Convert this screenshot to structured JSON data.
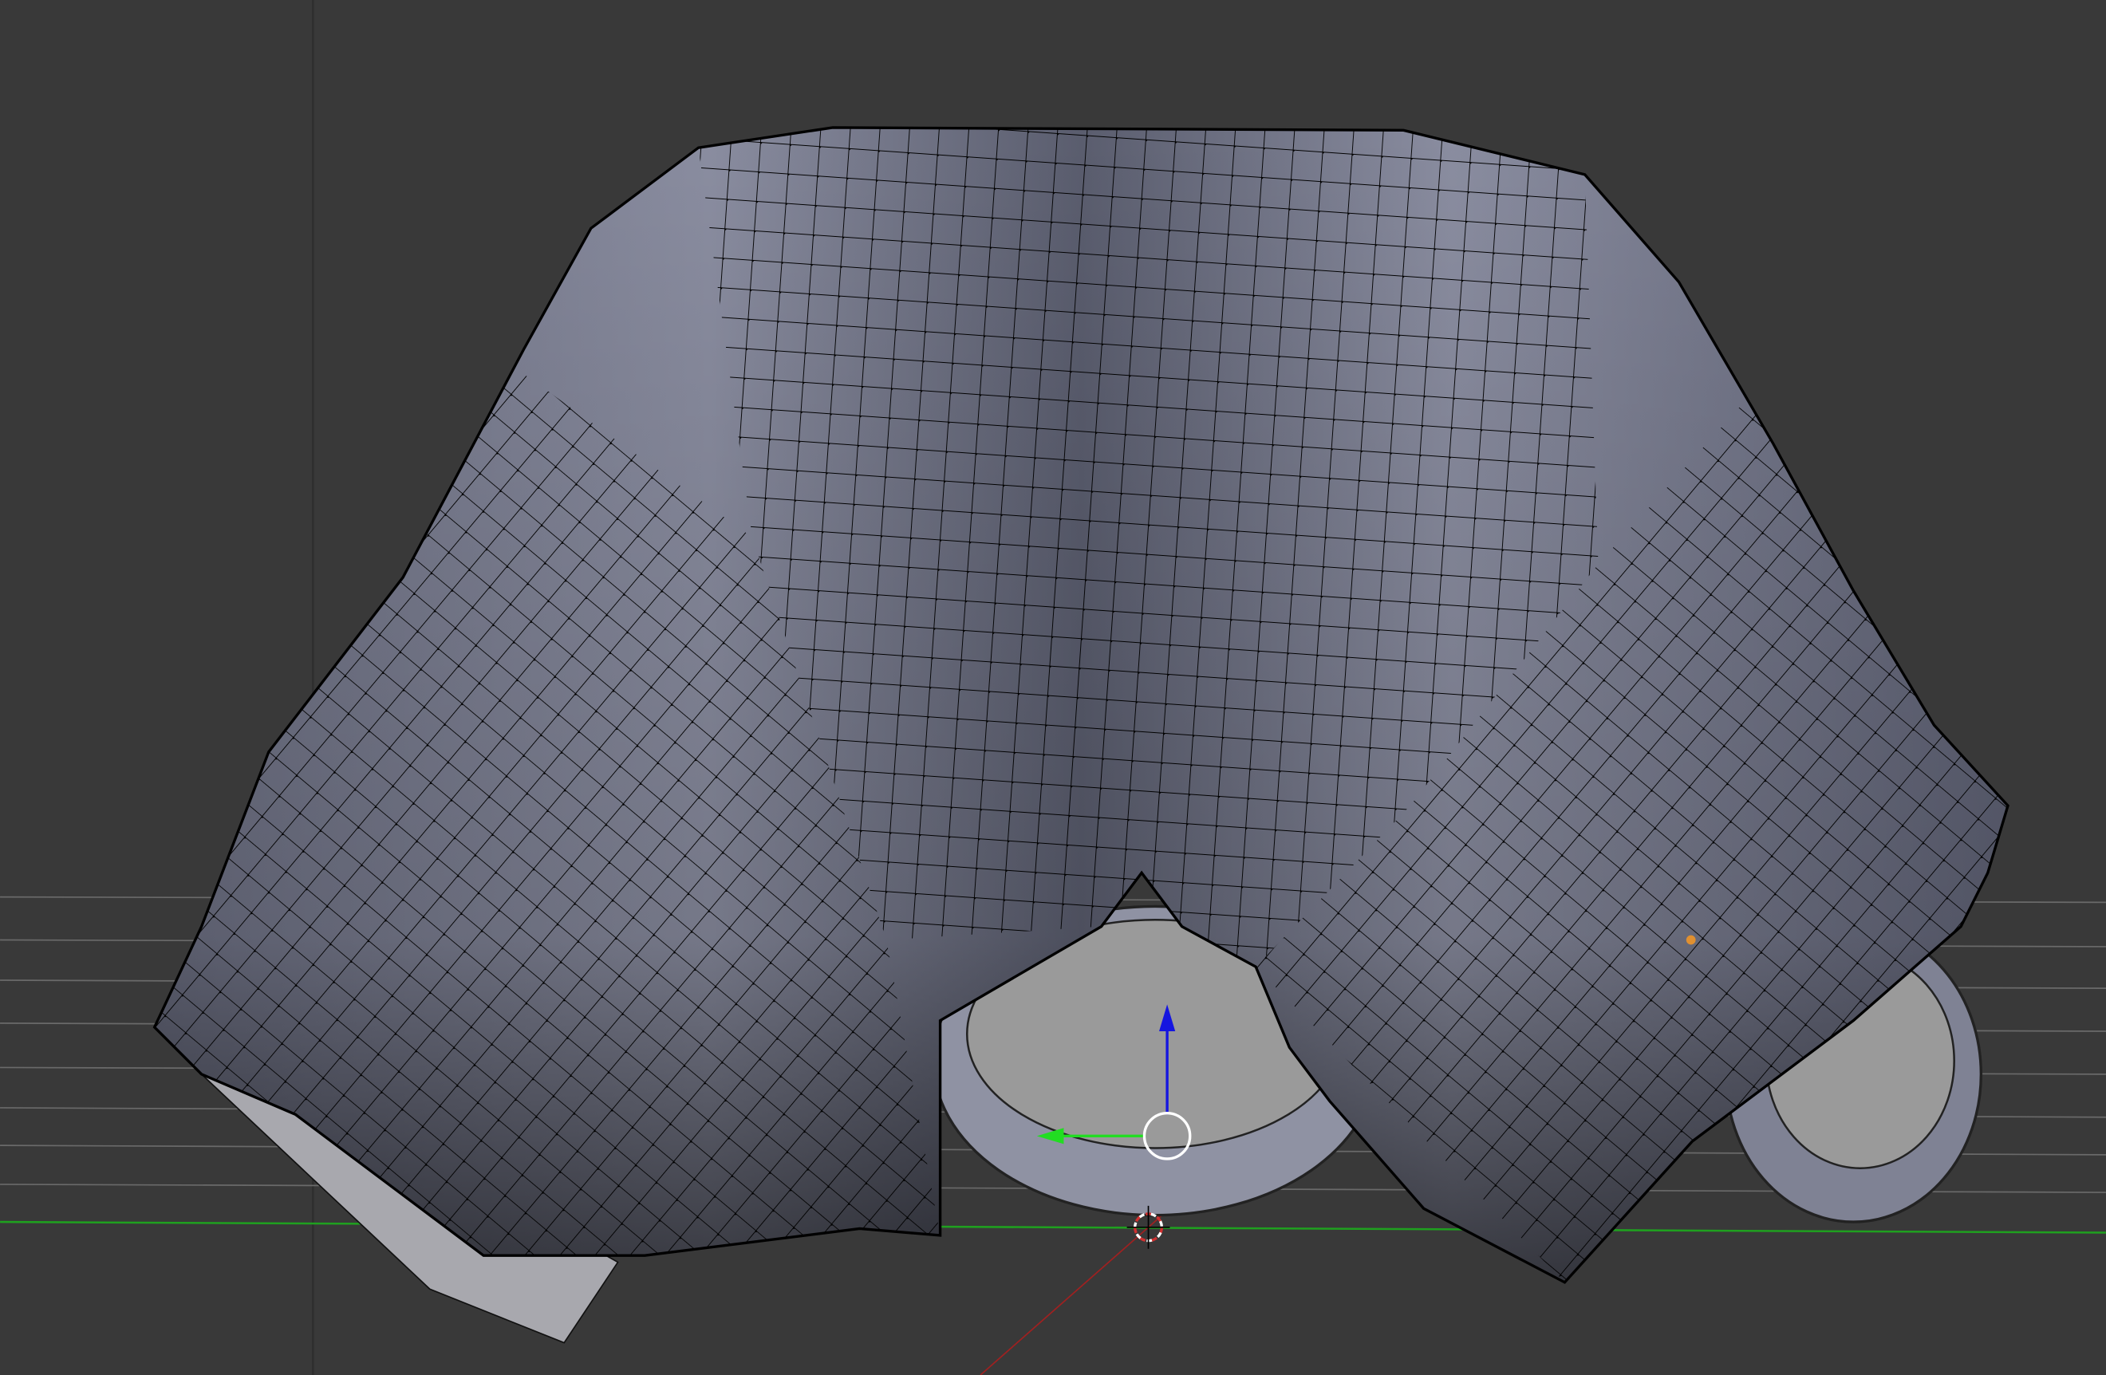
{
  "viewport": {
    "background_color": "#393939",
    "mesh_color": "#7d8094",
    "wire_color": "#000000",
    "grid_line_color": "#6a6a6a",
    "x_axis_color": "#1fa01f",
    "y_axis_color": "#a02020"
  },
  "gizmo": {
    "z_arrow_color": "#1515e0",
    "y_arrow_color": "#22dd22",
    "pivot_circle_color": "#ffffff"
  },
  "scene_objects": {
    "lamp_color": "#e09030",
    "cursor_color": "#d03030"
  }
}
